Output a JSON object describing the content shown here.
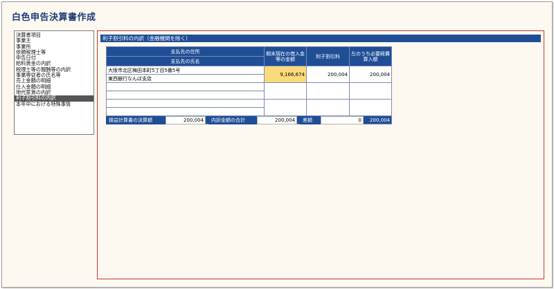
{
  "app_title": "白色申告決算書作成",
  "sidebar": {
    "items": [
      {
        "label": "決算書項目",
        "selected": false
      },
      {
        "label": "事業主",
        "selected": false
      },
      {
        "label": "事業所",
        "selected": false
      },
      {
        "label": "依頼税理士等",
        "selected": false
      },
      {
        "label": "申告日付",
        "selected": false
      },
      {
        "label": "給料賃金の内訳",
        "selected": false
      },
      {
        "label": "税理士等の報酬等の内訳",
        "selected": false
      },
      {
        "label": "事業専従者の氏名等",
        "selected": false
      },
      {
        "label": "売上金額の明細",
        "selected": false
      },
      {
        "label": "仕入金額の明細",
        "selected": false
      },
      {
        "label": "地代家賃の内訳",
        "selected": false
      },
      {
        "label": "利子割引料の内訳",
        "selected": true
      },
      {
        "label": "本年中における特殊事情",
        "selected": false
      }
    ]
  },
  "main": {
    "section_title": "利子割引料の内訳（金融機関を除く）",
    "table": {
      "headers": {
        "payee_address": "支払先の住所",
        "payee_name": "支払先の氏名",
        "balance": "期末現在の借入金等の金額",
        "interest": "利子割引料",
        "deductible": "左のうち必要経費算入額"
      },
      "rows": [
        {
          "address": "大阪市北区梅田本町5丁目5番5号",
          "name": "東西銀行なんば支店",
          "balance": "9,166,674",
          "interest": "200,004",
          "deductible": "200,004"
        },
        {
          "address": "",
          "name": "",
          "balance": "",
          "interest": "",
          "deductible": ""
        },
        {
          "address": "",
          "name": "",
          "balance": "",
          "interest": "",
          "deductible": ""
        }
      ],
      "total_deductible": "200,004"
    },
    "summary": {
      "pl_label": "損益計算書の決算額",
      "pl_value": "200,004",
      "breakdown_label": "内訳金額の合計",
      "breakdown_value": "200,004",
      "diff_label": "差額",
      "diff_value": "0"
    }
  },
  "colors": {
    "header_blue": "#1f4e96",
    "highlight": "#fcd97a",
    "panel_border": "#c0392b",
    "background": "#fdf9f0"
  }
}
